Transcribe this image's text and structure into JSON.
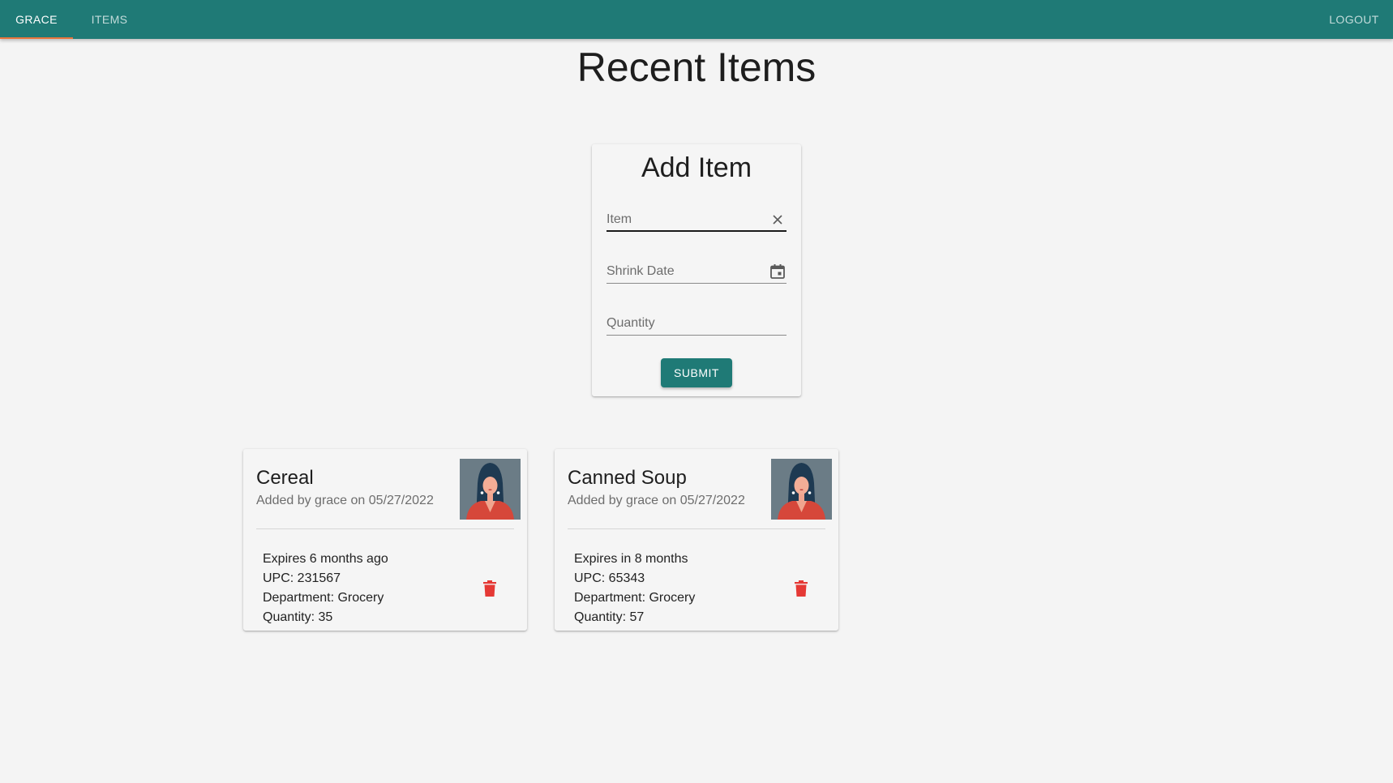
{
  "nav": {
    "tabs": [
      {
        "label": "GRACE",
        "active": true
      },
      {
        "label": "ITEMS",
        "active": false
      }
    ],
    "logout_label": "LOGOUT"
  },
  "page": {
    "title": "Recent Items"
  },
  "add_form": {
    "title": "Add Item",
    "fields": {
      "item": {
        "label": "Item",
        "value": ""
      },
      "shrink_date": {
        "label": "Shrink Date",
        "value": ""
      },
      "quantity": {
        "label": "Quantity",
        "value": ""
      }
    },
    "submit_label": "SUBMIT"
  },
  "items": [
    {
      "name": "Cereal",
      "added": "Added by grace on 05/27/2022",
      "expires": "Expires 6 months ago",
      "upc": "UPC: 231567",
      "department": "Department: Grocery",
      "quantity": "Quantity: 35"
    },
    {
      "name": "Canned Soup",
      "added": "Added by grace on 05/27/2022",
      "expires": "Expires in 8 months",
      "upc": "UPC: 65343",
      "department": "Department: Grocery",
      "quantity": "Quantity: 57"
    }
  ],
  "icons": {
    "clear": "close-icon",
    "calendar": "calendar-icon",
    "delete": "trash-icon",
    "avatar": "user-avatar"
  },
  "colors": {
    "primary": "#1f7a76",
    "tab_indicator": "#e8743b",
    "delete": "#e53935",
    "background": "#f4f4f4"
  }
}
